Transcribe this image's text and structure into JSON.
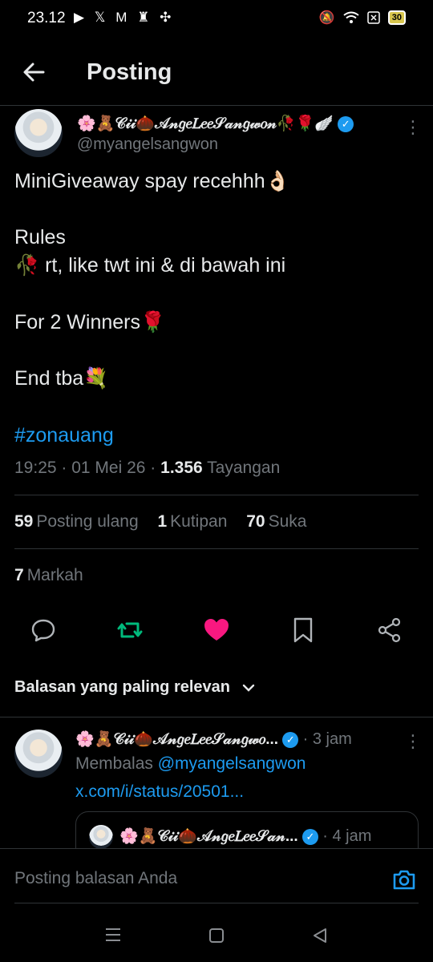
{
  "status_bar": {
    "time": "23.12",
    "left_icons": "▶ 𝕏 M ♜ ✣",
    "battery": "30"
  },
  "header": {
    "title": "Posting"
  },
  "tweet": {
    "display_name": "🌸🧸𝒞𝒾𝒾🌰𝒜𝓃𝑔𝑒𝐿𝑒𝑒𝒮𝒶𝓃𝑔𝓌𝑜𝓃🥀🌹🪽",
    "handle": "@myangelsangwon",
    "lines": [
      "MiniGiveaway spay recehhh👌🏻",
      "Rules",
      "🥀 rt, like twt ini & di bawah ini",
      "For 2 Winners🌹",
      "End tba💐"
    ],
    "hashtag": "#zonauang",
    "time": "19:25",
    "date": "01 Mei 26",
    "views_count": "1.356",
    "views_label": "Tayangan"
  },
  "stats": {
    "reposts_count": "59",
    "reposts_label": "Posting ulang",
    "quotes_count": "1",
    "quotes_label": "Kutipan",
    "likes_count": "70",
    "likes_label": "Suka",
    "bookmarks_count": "7",
    "bookmarks_label": "Markah"
  },
  "actions": [
    "reply-icon",
    "repost-icon",
    "like-icon",
    "bookmark-icon",
    "share-icon"
  ],
  "colors": {
    "accent": "#1d9bf0",
    "repost": "#00ba7c",
    "like": "#f91880"
  },
  "sort_label": "Balasan yang paling relevan",
  "reply": {
    "display_name": "🌸🧸𝒞𝒾𝒾🌰𝒜𝓃𝑔𝑒𝐿𝑒𝑒𝒮𝒶𝓃𝑔𝓌𝑜...",
    "time": "· 3 jam",
    "replying_prefix": "Membalas",
    "replying_to": "@myangelsangwon",
    "link": "x.com/i/status/20501...",
    "quote_name": "🌸🧸𝒞𝒾𝒾🌰𝒜𝓃𝑔𝑒𝐿𝑒𝑒𝒮𝒶𝓃...",
    "quote_time": "· 4 jam"
  },
  "composer": {
    "placeholder": "Posting balasan Anda"
  }
}
